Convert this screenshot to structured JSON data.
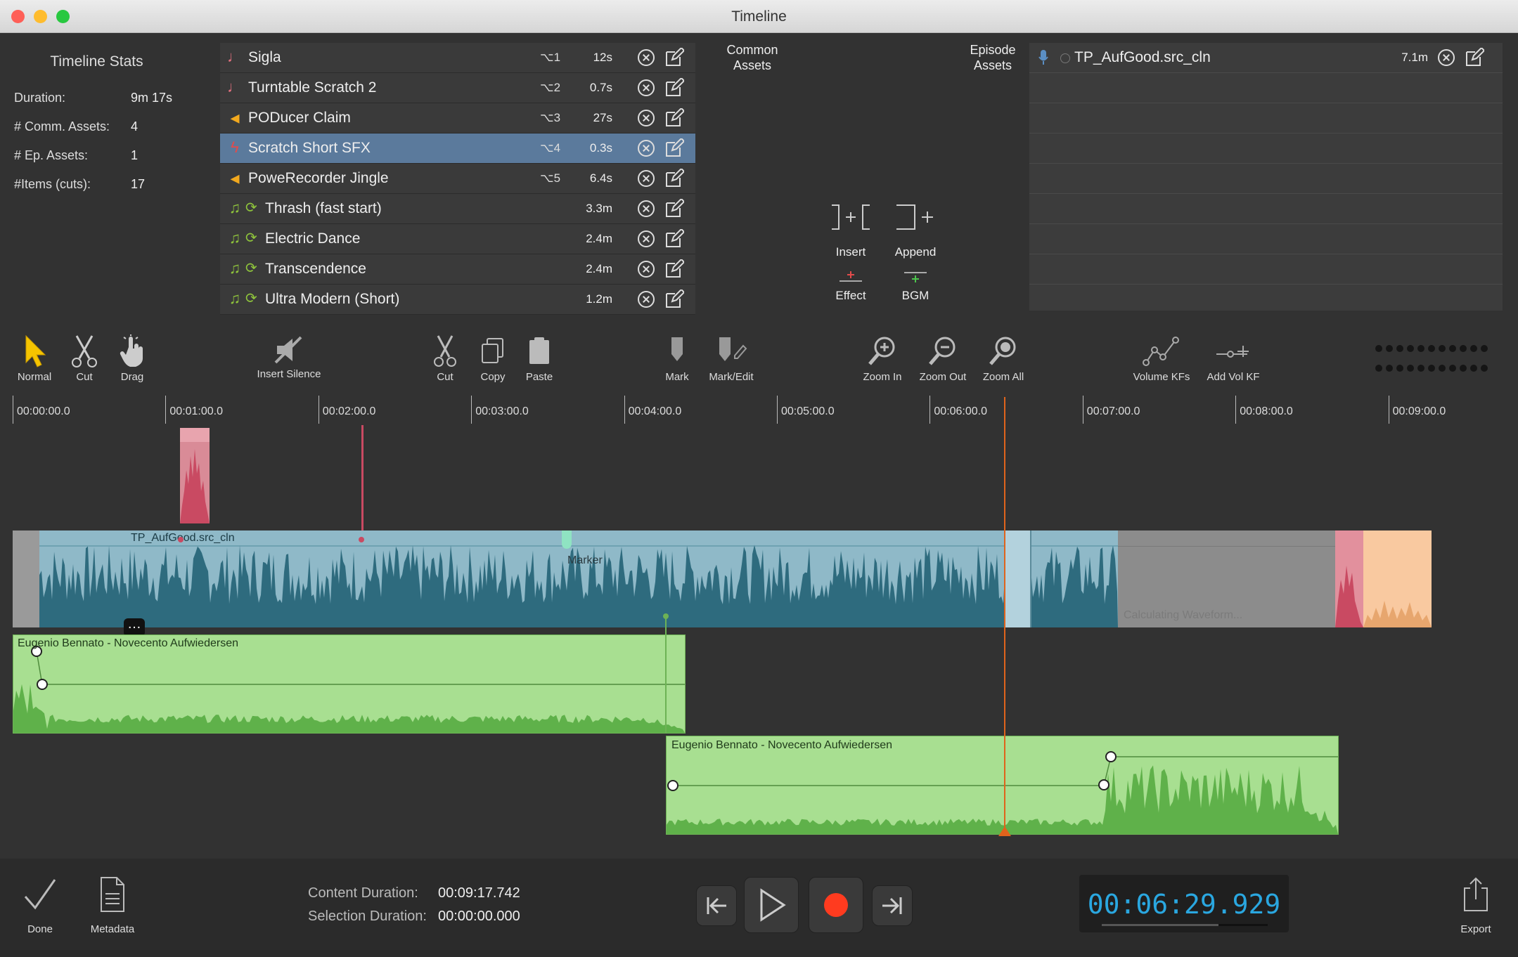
{
  "window": {
    "title": "Timeline"
  },
  "stats": {
    "title": "Timeline Stats",
    "rows": [
      {
        "label": "Duration:",
        "value": "9m 17s"
      },
      {
        "label": "# Comm. Assets:",
        "value": "4"
      },
      {
        "label": "# Ep. Assets:",
        "value": "1"
      },
      {
        "label": "#Items (cuts):",
        "value": "17"
      }
    ]
  },
  "common_assets": {
    "label": "Common\nAssets",
    "items": [
      {
        "name": "Sigla",
        "key": "⌥1",
        "duration": "12s",
        "icon": "note-icon",
        "loop": false,
        "selected": false
      },
      {
        "name": "Turntable Scratch 2",
        "key": "⌥2",
        "duration": "0.7s",
        "icon": "note-icon",
        "loop": false,
        "selected": false
      },
      {
        "name": "PODucer Claim",
        "key": "⌥3",
        "duration": "27s",
        "icon": "megaphone-icon",
        "loop": false,
        "selected": false
      },
      {
        "name": "Scratch Short SFX",
        "key": "⌥4",
        "duration": "0.3s",
        "icon": "bolt-icon",
        "loop": false,
        "selected": true
      },
      {
        "name": "PoweRecorder Jingle",
        "key": "⌥5",
        "duration": "6.4s",
        "icon": "megaphone-icon",
        "loop": false,
        "selected": false
      },
      {
        "name": "Thrash (fast start)",
        "key": "",
        "duration": "3.3m",
        "icon": "music-icon",
        "loop": true,
        "selected": false
      },
      {
        "name": "Electric Dance",
        "key": "",
        "duration": "2.4m",
        "icon": "music-icon",
        "loop": true,
        "selected": false
      },
      {
        "name": "Transcendence",
        "key": "",
        "duration": "2.4m",
        "icon": "music-icon",
        "loop": true,
        "selected": false
      },
      {
        "name": "Ultra Modern (Short)",
        "key": "",
        "duration": "1.2m",
        "icon": "music-icon",
        "loop": true,
        "selected": false
      }
    ]
  },
  "episode_assets": {
    "label": "Episode\nAssets",
    "items": [
      {
        "name": "TP_AufGood.src_cln",
        "duration": "7.1m",
        "icon": "microphone-icon"
      }
    ]
  },
  "insert_actions": {
    "insert": "Insert",
    "append": "Append",
    "effect": "Effect",
    "bgm": "BGM"
  },
  "toolbar": {
    "normal": "Normal",
    "cut_mode": "Cut",
    "drag": "Drag",
    "insert_silence": "Insert Silence",
    "cut": "Cut",
    "copy": "Copy",
    "paste": "Paste",
    "mark": "Mark",
    "mark_edit": "Mark/Edit",
    "zoom_in": "Zoom In",
    "zoom_out": "Zoom Out",
    "zoom_all": "Zoom All",
    "volume_kfs": "Volume KFs",
    "add_vol_kf": "Add Vol KF"
  },
  "ruler": {
    "labels": [
      "00:00:00.0",
      "00:01:00.0",
      "00:02:00.0",
      "00:03:00.0",
      "00:04:00.0",
      "00:05:00.0",
      "00:06:00.0",
      "00:07:00.0",
      "00:08:00.0",
      "00:09:00.0"
    ]
  },
  "tracks": {
    "main_clip": "TP_AufGood.src_cln",
    "marker": "Marker",
    "calculating": "Calculating Waveform...",
    "bgm_clip_1": "Eugenio Bennato - Novecento Aufwiedersen",
    "bgm_clip_2": "Eugenio Bennato - Novecento Aufwiedersen"
  },
  "bottom": {
    "done": "Done",
    "metadata": "Metadata",
    "content_duration_label": "Content Duration:",
    "content_duration": "00:09:17.742",
    "selection_duration_label": "Selection Duration:",
    "selection_duration": "00:00:00.000",
    "timecode": "00:06:29.929",
    "export": "Export"
  },
  "colors": {
    "selection": "#5b7a9c",
    "main_clip": "#7aaabb",
    "waveform": "#2e6b7e",
    "bgm_clip": "#a6dd8f",
    "playhead": "#e0631c",
    "timecode": "#2aa7e0",
    "record": "#ff3b1f"
  }
}
